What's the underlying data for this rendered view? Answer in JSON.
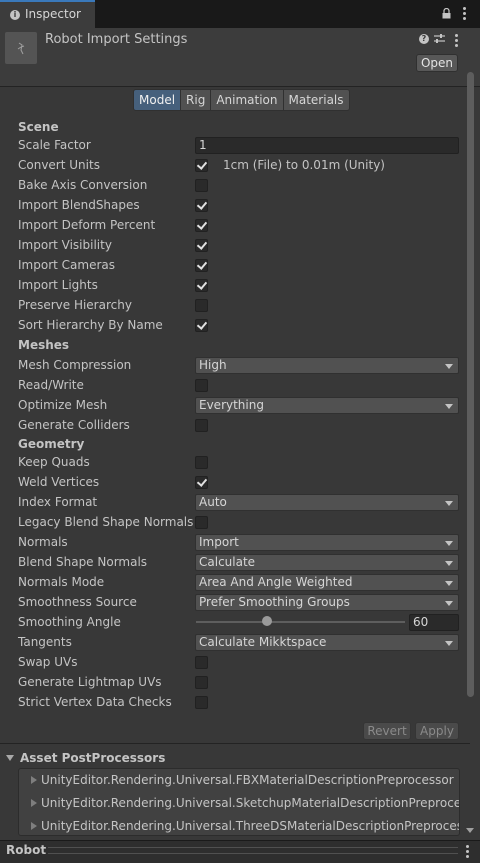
{
  "tab": {
    "label": "Inspector"
  },
  "header": {
    "title": "Robot Import Settings",
    "open_label": "Open"
  },
  "toolbar": {
    "tabs": [
      "Model",
      "Rig",
      "Animation",
      "Materials"
    ],
    "active": "Model"
  },
  "scene": {
    "heading": "Scene",
    "scale_factor_label": "Scale Factor",
    "scale_factor_value": "1",
    "convert_units_label": "Convert Units",
    "convert_units_checked": true,
    "convert_units_note": "1cm (File) to 0.01m (Unity)",
    "bake_axis_label": "Bake Axis Conversion",
    "bake_axis_checked": false,
    "blendshapes_label": "Import BlendShapes",
    "blendshapes_checked": true,
    "deform_percent_label": "Import Deform Percent",
    "deform_percent_checked": true,
    "visibility_label": "Import Visibility",
    "visibility_checked": true,
    "cameras_label": "Import Cameras",
    "cameras_checked": true,
    "lights_label": "Import Lights",
    "lights_checked": true,
    "preserve_hierarchy_label": "Preserve Hierarchy",
    "preserve_hierarchy_checked": false,
    "sort_hierarchy_label": "Sort Hierarchy By Name",
    "sort_hierarchy_checked": true
  },
  "meshes": {
    "heading": "Meshes",
    "compression_label": "Mesh Compression",
    "compression_value": "High",
    "read_write_label": "Read/Write",
    "read_write_checked": false,
    "optimize_label": "Optimize Mesh",
    "optimize_value": "Everything",
    "colliders_label": "Generate Colliders",
    "colliders_checked": false
  },
  "geometry": {
    "heading": "Geometry",
    "keep_quads_label": "Keep Quads",
    "keep_quads_checked": false,
    "weld_label": "Weld Vertices",
    "weld_checked": true,
    "index_format_label": "Index Format",
    "index_format_value": "Auto",
    "legacy_blend_label": "Legacy Blend Shape Normals",
    "legacy_blend_checked": false,
    "normals_label": "Normals",
    "normals_value": "Import",
    "blend_normals_label": "Blend Shape Normals",
    "blend_normals_value": "Calculate",
    "normals_mode_label": "Normals Mode",
    "normals_mode_value": "Area And Angle Weighted",
    "smoothness_label": "Smoothness Source",
    "smoothness_value": "Prefer Smoothing Groups",
    "smoothing_angle_label": "Smoothing Angle",
    "smoothing_angle_value": "60",
    "smoothing_angle_fraction": 0.333,
    "tangents_label": "Tangents",
    "tangents_value": "Calculate Mikktspace",
    "swap_uvs_label": "Swap UVs",
    "swap_uvs_checked": false,
    "lightmap_uvs_label": "Generate Lightmap UVs",
    "lightmap_uvs_checked": false,
    "strict_label": "Strict Vertex Data Checks",
    "strict_checked": false
  },
  "actions": {
    "revert_label": "Revert",
    "apply_label": "Apply"
  },
  "post_processors": {
    "heading": "Asset PostProcessors",
    "items": [
      "UnityEditor.Rendering.Universal.FBXMaterialDescriptionPreprocessor",
      "UnityEditor.Rendering.Universal.SketchupMaterialDescriptionPreprocessor",
      "UnityEditor.Rendering.Universal.ThreeDSMaterialDescriptionPreprocessor"
    ]
  },
  "preview": {
    "label": "Robot"
  }
}
